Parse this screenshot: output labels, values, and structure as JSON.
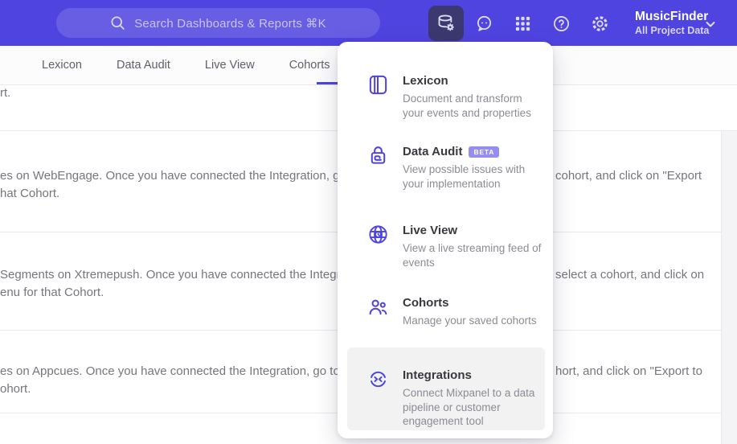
{
  "header": {
    "search_placeholder": "Search Dashboards & Reports ⌘K",
    "project_name": "MusicFinder",
    "project_scope": "All Project Data",
    "icons": [
      "search-icon",
      "data-management-icon",
      "feedback-bubble-icon",
      "apps-grid-icon",
      "help-icon",
      "settings-gear-icon",
      "chevron-down-icon"
    ]
  },
  "nav": {
    "tabs": [
      {
        "label": "Lexicon"
      },
      {
        "label": "Data Audit"
      },
      {
        "label": "Live View"
      },
      {
        "label": "Cohorts"
      }
    ]
  },
  "content": {
    "rows": [
      {
        "line1": "rt.",
        "line2": "",
        "right": ""
      },
      {
        "line1": "es on WebEngage. Once you have connected the Integration, go to the",
        "right": "cohort, and click on \"Export",
        "line2": "hat Cohort."
      },
      {
        "line1": "Segments on Xtremepush. Once you have connected the Integration,",
        "right": "select a cohort, and click on",
        "line2": "enu for that Cohort."
      },
      {
        "line1": "es on Appcues. Once you have connected the Integration, go to the M",
        "right": "hort, and click on \"Export to",
        "line2": "ohort."
      }
    ]
  },
  "menu": {
    "items": [
      {
        "title": "Lexicon",
        "desc": "Document and transform your events and properties",
        "icon": "lexicon-book-icon"
      },
      {
        "title": "Data Audit",
        "badge": "BETA",
        "desc": "View possible issues with your implementation",
        "icon": "data-audit-lock-icon"
      },
      {
        "title": "Live View",
        "desc": "View a live streaming feed of events",
        "icon": "live-view-globe-icon"
      },
      {
        "title": "Cohorts",
        "desc": "Manage your saved cohorts",
        "icon": "cohorts-people-icon"
      },
      {
        "title": "Integrations",
        "desc": "Connect Mixpanel to a data pipeline or customer engagement tool",
        "icon": "integrations-sync-icon",
        "highlighted": true
      }
    ]
  },
  "colors": {
    "header_bg": "#4f44e0",
    "accent": "#4f44e0",
    "active_icon_button_bg": "#3c3870",
    "beta_badge_bg": "#968df0",
    "menu_highlight_bg": "#f2f2f3",
    "side_panel_bg": "#f4f4f6"
  }
}
